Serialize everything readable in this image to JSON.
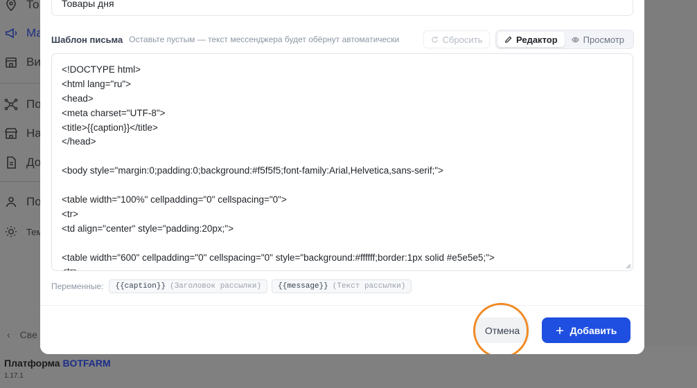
{
  "sidebar": {
    "items": [
      {
        "icon": "map-pin-icon",
        "label": "То"
      },
      {
        "icon": "megaphone-icon",
        "label": "Ма",
        "active": true
      },
      {
        "icon": "store-icon",
        "label": "Ви"
      },
      {
        "icon": "network-icon",
        "label": "По"
      },
      {
        "icon": "shop-icon",
        "label": "На"
      },
      {
        "icon": "document-icon",
        "label": "До"
      },
      {
        "icon": "user-icon",
        "label": "По"
      },
      {
        "icon": "sun-icon",
        "label": "Тем"
      }
    ],
    "collapse_label": "Све",
    "brand_prefix": "Платформа",
    "brand_name": "BOTFARM",
    "version": "1.17.1"
  },
  "modal": {
    "title_value": "Товары дня",
    "template_label": "Шаблон письма",
    "template_hint": "Оставьте пустым — текст мессенджера будет обёрнут автоматически",
    "reset_label": "Сбросить",
    "editor_tab_label": "Редактор",
    "preview_tab_label": "Просмотр",
    "code_lines": [
      "<!DOCTYPE html>",
      "<html lang=\"ru\">",
      "<head>",
      "<meta charset=\"UTF-8\">",
      "<title>{{caption}}</title>",
      "</head>",
      "",
      "<body style=\"margin:0;padding:0;background:#f5f5f5;font-family:Arial,Helvetica,sans-serif;\">",
      "",
      "<table width=\"100%\" cellpadding=\"0\" cellspacing=\"0\">",
      "<tr>",
      "<td align=\"center\" style=\"padding:20px;\">",
      "",
      "<table width=\"600\" cellpadding=\"0\" cellspacing=\"0\" style=\"background:#ffffff;border:1px solid #e5e5e5;\">",
      "<tr>"
    ],
    "variables_label": "Переменные:",
    "variables": [
      {
        "code": "{{caption}}",
        "desc": "(Заголовок рассылки)"
      },
      {
        "code": "{{message}}",
        "desc": "(Текст рассылки)"
      }
    ],
    "cancel_label": "Отмена",
    "add_label": "Добавить"
  },
  "colors": {
    "accent": "#1f4fe0",
    "focus_ring": "#f08a24",
    "overlay": "#7b7b7b"
  }
}
